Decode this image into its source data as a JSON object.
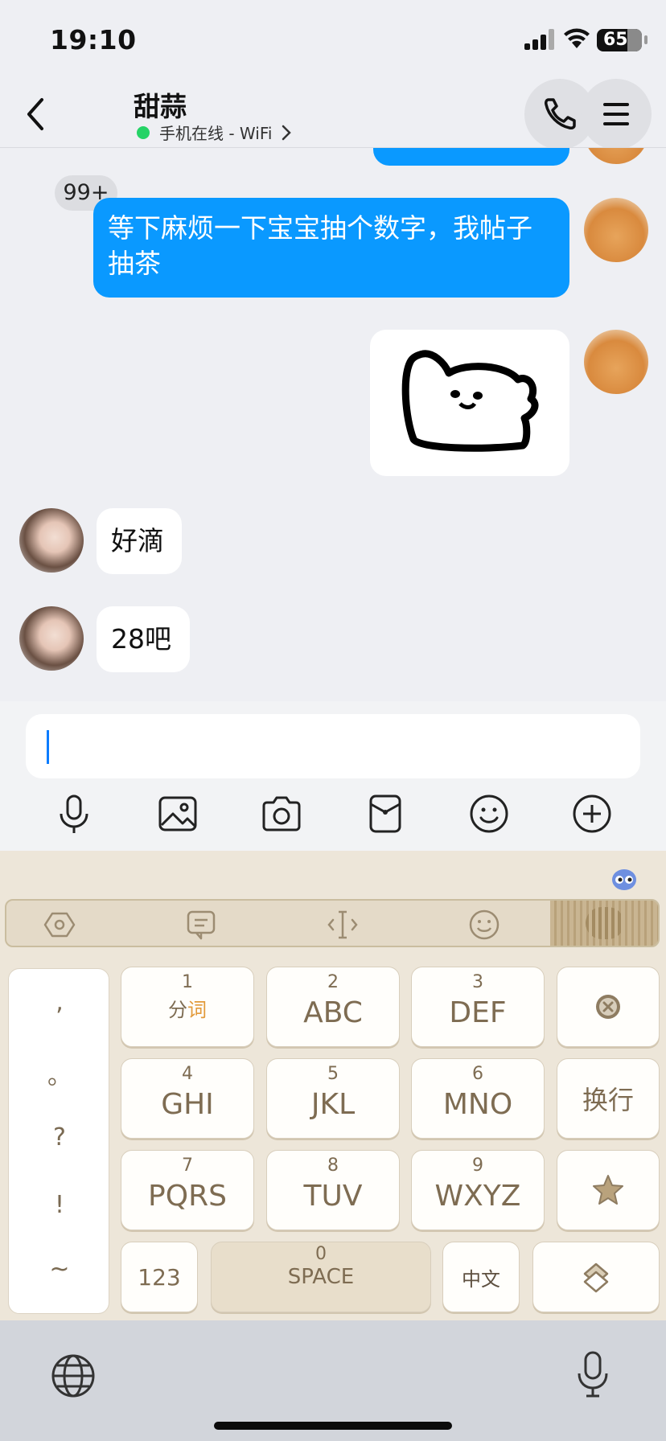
{
  "status_bar": {
    "time": "19:10",
    "battery": "65"
  },
  "header": {
    "badge": "99+",
    "contact_name": "甜蒜",
    "online_status": "手机在线 - WiFi"
  },
  "messages": [
    {
      "from": "me",
      "type": "text",
      "text_line1": "等下麻烦一下宝宝抽个数字，我帖子",
      "text_line2": "抽茶"
    },
    {
      "from": "me",
      "type": "sticker"
    },
    {
      "from": "contact",
      "type": "text",
      "text": "好滴"
    },
    {
      "from": "contact",
      "type": "text",
      "text": "28吧"
    }
  ],
  "input": {
    "value": ""
  },
  "keyboard": {
    "punct": [
      ",",
      "。",
      "?",
      "!",
      "~"
    ],
    "keys": [
      {
        "num": "1",
        "label_a": "分",
        "label_b": "词"
      },
      {
        "num": "2",
        "label": "ABC"
      },
      {
        "num": "3",
        "label": "DEF"
      },
      {
        "num": "4",
        "label": "GHI"
      },
      {
        "num": "5",
        "label": "JKL"
      },
      {
        "num": "6",
        "label": "MNO"
      },
      {
        "num": "7",
        "label": "PQRS"
      },
      {
        "num": "8",
        "label": "TUV"
      },
      {
        "num": "9",
        "label": "WXYZ"
      }
    ],
    "newline_label": "换行",
    "num_label": "123",
    "space_num": "0",
    "space_label": "SPACE",
    "lang_label": "中文"
  },
  "colors": {
    "bubble_out": "#0A99FF",
    "online_dot": "#25D366",
    "keyboard_bg": "#EDE6D9",
    "key_text": "#7E6C52"
  }
}
